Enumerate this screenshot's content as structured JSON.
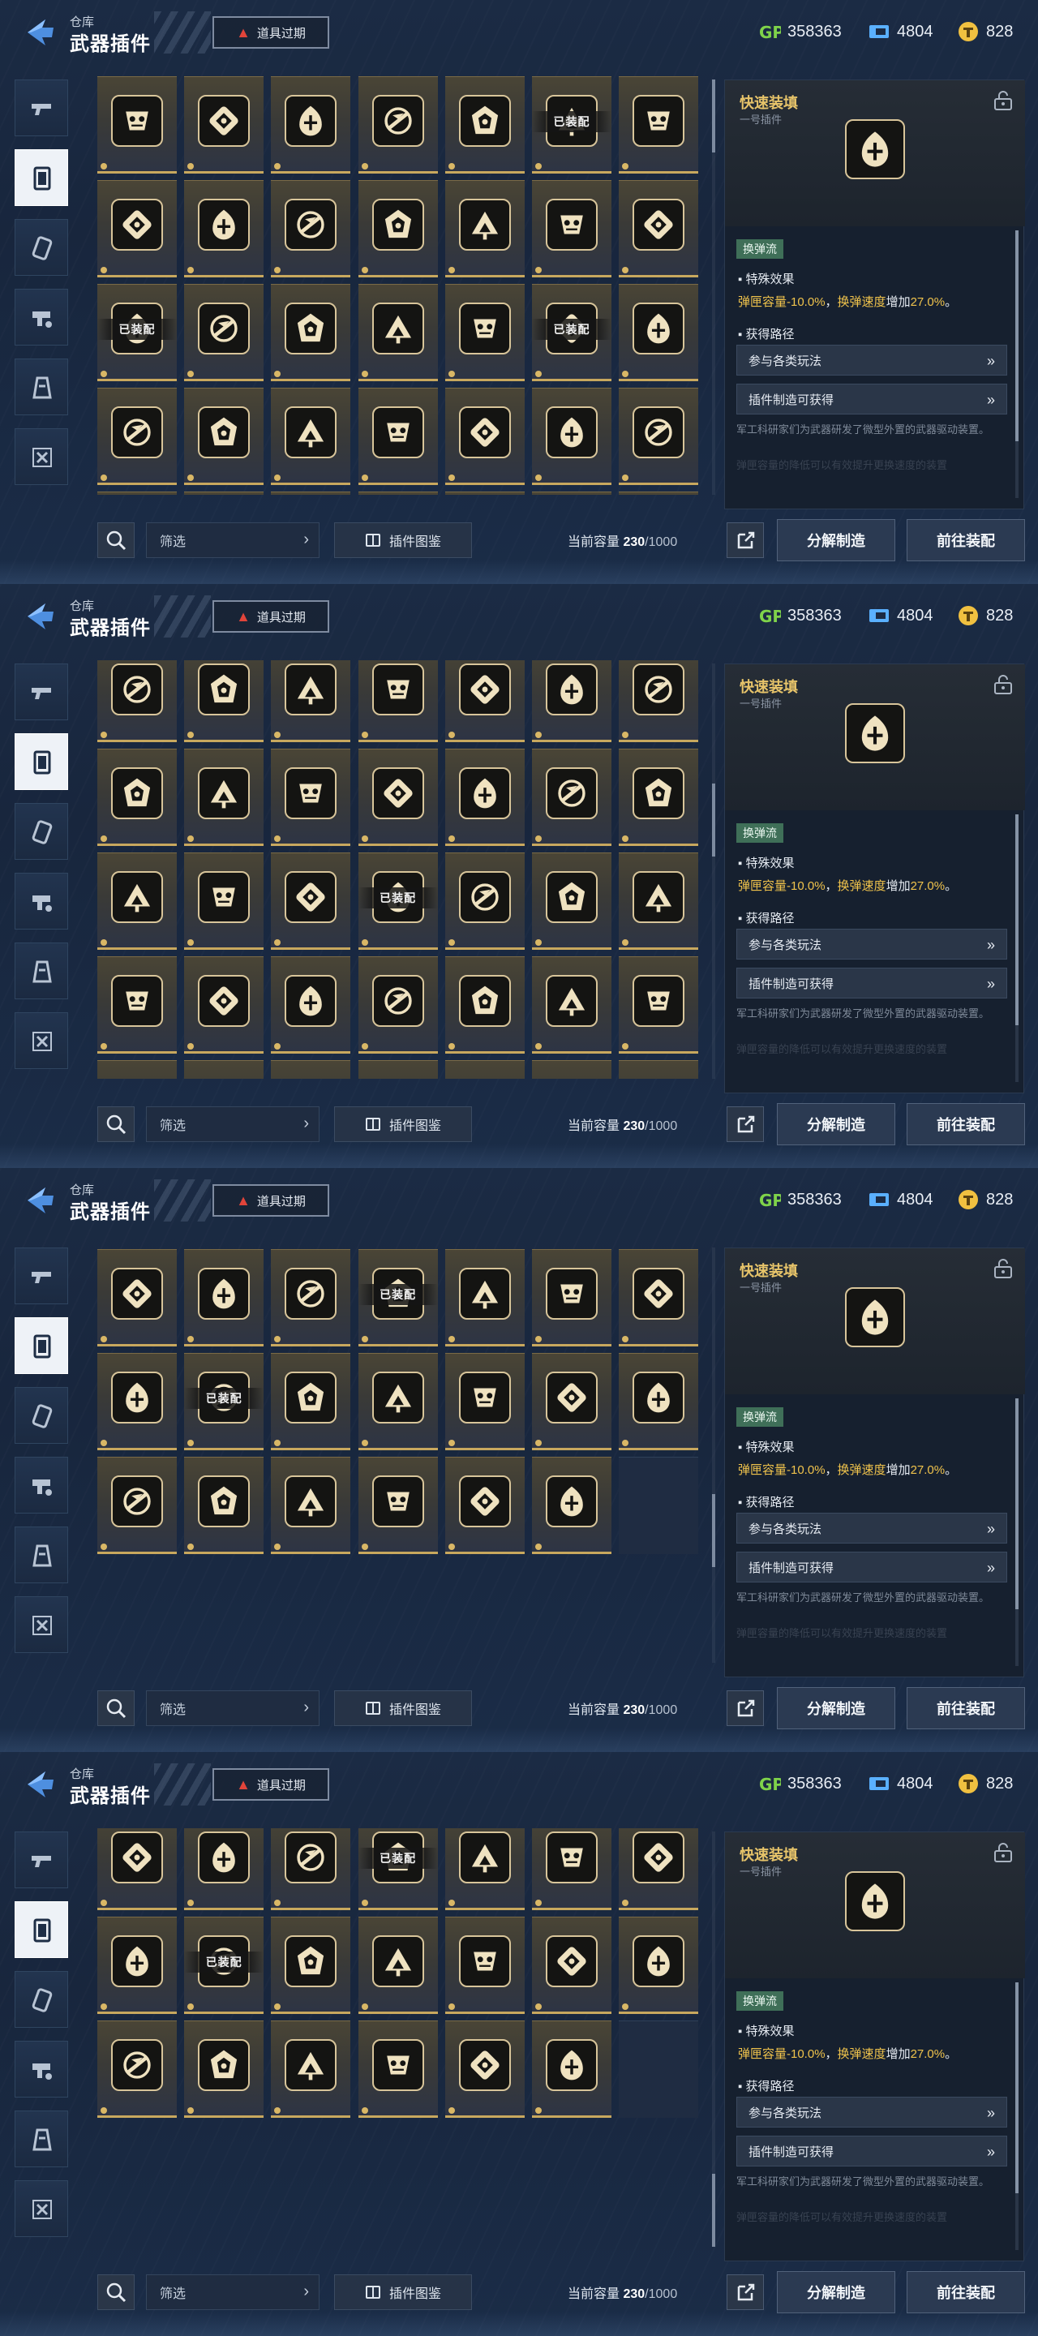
{
  "header": {
    "breadcrumb": "仓库",
    "title": "武器插件",
    "expired_label": "道具过期",
    "currencies": [
      {
        "icon": "gp-currency-icon",
        "value": "358363",
        "color": "#7fd34a"
      },
      {
        "icon": "ticket-currency-icon",
        "value": "4804",
        "color": "#5ab0ff"
      },
      {
        "icon": "coin-currency-icon",
        "value": "828",
        "color": "#f0c040"
      }
    ]
  },
  "side_tabs": [
    {
      "name": "pistol-icon",
      "active": false
    },
    {
      "name": "plugin-chip-icon",
      "active": true
    },
    {
      "name": "ammo-icon",
      "active": false
    },
    {
      "name": "gun-parts-icon",
      "active": false
    },
    {
      "name": "tower-icon",
      "active": false
    },
    {
      "name": "crate-icon",
      "active": false
    }
  ],
  "equipped_label": "已装配",
  "plugins": [
    {
      "icon": "plugin-icon-01",
      "equipped": false
    },
    {
      "icon": "plugin-icon-02",
      "equipped": false
    },
    {
      "icon": "plugin-icon-03",
      "equipped": false
    },
    {
      "icon": "plugin-icon-04",
      "equipped": false
    },
    {
      "icon": "plugin-icon-05",
      "equipped": false
    },
    {
      "icon": "plugin-icon-06",
      "equipped": true
    },
    {
      "icon": "plugin-icon-07",
      "equipped": false
    },
    {
      "icon": "plugin-icon-08",
      "equipped": false
    },
    {
      "icon": "plugin-icon-09",
      "equipped": false
    },
    {
      "icon": "plugin-icon-10",
      "equipped": false
    },
    {
      "icon": "plugin-icon-11",
      "equipped": false
    },
    {
      "icon": "plugin-icon-12",
      "equipped": false
    },
    {
      "icon": "plugin-icon-13",
      "equipped": false
    },
    {
      "icon": "plugin-icon-14",
      "equipped": false
    },
    {
      "icon": "plugin-icon-15",
      "equipped": true
    },
    {
      "icon": "plugin-icon-16",
      "equipped": false
    },
    {
      "icon": "plugin-icon-17",
      "equipped": false
    },
    {
      "icon": "plugin-icon-18",
      "equipped": false
    },
    {
      "icon": "plugin-icon-19",
      "equipped": false
    },
    {
      "icon": "plugin-icon-20",
      "equipped": true
    },
    {
      "icon": "plugin-icon-21",
      "equipped": false
    },
    {
      "icon": "plugin-icon-22",
      "equipped": false
    },
    {
      "icon": "plugin-icon-23",
      "equipped": false
    },
    {
      "icon": "plugin-icon-24",
      "equipped": false
    },
    {
      "icon": "plugin-icon-25",
      "equipped": false
    },
    {
      "icon": "plugin-icon-26",
      "equipped": false
    },
    {
      "icon": "plugin-icon-27",
      "equipped": false
    },
    {
      "icon": "plugin-icon-28",
      "equipped": false
    },
    {
      "icon": "plugin-icon-29",
      "equipped": false
    },
    {
      "icon": "plugin-icon-30",
      "equipped": false
    },
    {
      "icon": "plugin-icon-31",
      "equipped": false
    },
    {
      "icon": "plugin-icon-32",
      "equipped": false
    },
    {
      "icon": "plugin-icon-33",
      "equipped": false
    },
    {
      "icon": "plugin-icon-34",
      "equipped": false
    },
    {
      "icon": "plugin-icon-35",
      "equipped": false
    },
    {
      "icon": "plugin-icon-36",
      "equipped": false
    },
    {
      "icon": "plugin-icon-37",
      "equipped": false
    },
    {
      "icon": "plugin-icon-38",
      "equipped": false
    },
    {
      "icon": "plugin-icon-39",
      "equipped": true
    },
    {
      "icon": "plugin-icon-40",
      "equipped": false
    },
    {
      "icon": "plugin-icon-41",
      "equipped": false
    },
    {
      "icon": "plugin-icon-42",
      "equipped": false
    },
    {
      "icon": "plugin-icon-43",
      "equipped": false
    },
    {
      "icon": "plugin-icon-44",
      "equipped": false
    },
    {
      "icon": "plugin-icon-45",
      "equipped": false
    },
    {
      "icon": "plugin-icon-46",
      "equipped": false
    },
    {
      "icon": "plugin-icon-47",
      "equipped": false
    },
    {
      "icon": "plugin-icon-48",
      "equipped": false
    },
    {
      "icon": "plugin-icon-49",
      "equipped": false
    },
    {
      "icon": "plugin-icon-50",
      "equipped": false
    },
    {
      "icon": "plugin-icon-51",
      "equipped": false
    },
    {
      "icon": "plugin-icon-52",
      "equipped": false
    },
    {
      "icon": "plugin-icon-53",
      "equipped": true
    },
    {
      "icon": "plugin-icon-54",
      "equipped": false
    },
    {
      "icon": "plugin-icon-55",
      "equipped": false
    },
    {
      "icon": "plugin-icon-56",
      "equipped": false
    },
    {
      "icon": "plugin-icon-57",
      "equipped": false
    },
    {
      "icon": "plugin-icon-58",
      "equipped": true
    },
    {
      "icon": "plugin-icon-59",
      "equipped": false
    },
    {
      "icon": "plugin-icon-60",
      "equipped": false
    },
    {
      "icon": "plugin-icon-61",
      "equipped": false
    },
    {
      "icon": "plugin-icon-62",
      "equipped": false
    },
    {
      "icon": "plugin-icon-63",
      "equipped": false
    },
    {
      "icon": "plugin-icon-64",
      "equipped": false
    },
    {
      "icon": "plugin-icon-65",
      "equipped": false
    },
    {
      "icon": "plugin-icon-66",
      "equipped": false
    },
    {
      "icon": "plugin-icon-67",
      "equipped": false
    },
    {
      "icon": "plugin-icon-68",
      "equipped": false
    },
    {
      "icon": "plugin-icon-69",
      "equipped": false
    },
    {
      "icon": "",
      "equipped": false,
      "empty": true
    }
  ],
  "detail": {
    "name": "快速装填",
    "subtitle": "一号插件",
    "icon": "plugin-icon-39",
    "tag": "换弹流",
    "effect_heading": "▪ 特殊效果",
    "effect": {
      "part1": "弹匣容量-10.0%",
      "sep": "，",
      "part2_label": "换弹速度",
      "part2_mid": "增加",
      "part2_value": "27.0%",
      "end": "。"
    },
    "route_heading": "▪ 获得路径",
    "routes": [
      "参与各类玩法",
      "插件制造可获得"
    ],
    "description": "军工科研家们为武器研发了微型外置的武器驱动装置。",
    "description_faded": "弹匣容量的降低可以有效提升更换速度的装置"
  },
  "footer": {
    "filter_label": "筛选",
    "atlas_label": "插件图鉴",
    "capacity_label": "当前容量",
    "capacity_used": "230",
    "capacity_max": "/1000",
    "dismantle_label": "分解制造",
    "equip_label": "前往装配"
  },
  "views": [
    {
      "scroll_rows": 0,
      "scrollbar_position": 0.0
    },
    {
      "scroll_rows": 3.15,
      "scrollbar_position": 0.35
    },
    {
      "scroll_rows": 6.95,
      "scrollbar_position": 0.72
    },
    {
      "scroll_rows": 7.15,
      "scrollbar_position": 1.0
    }
  ]
}
